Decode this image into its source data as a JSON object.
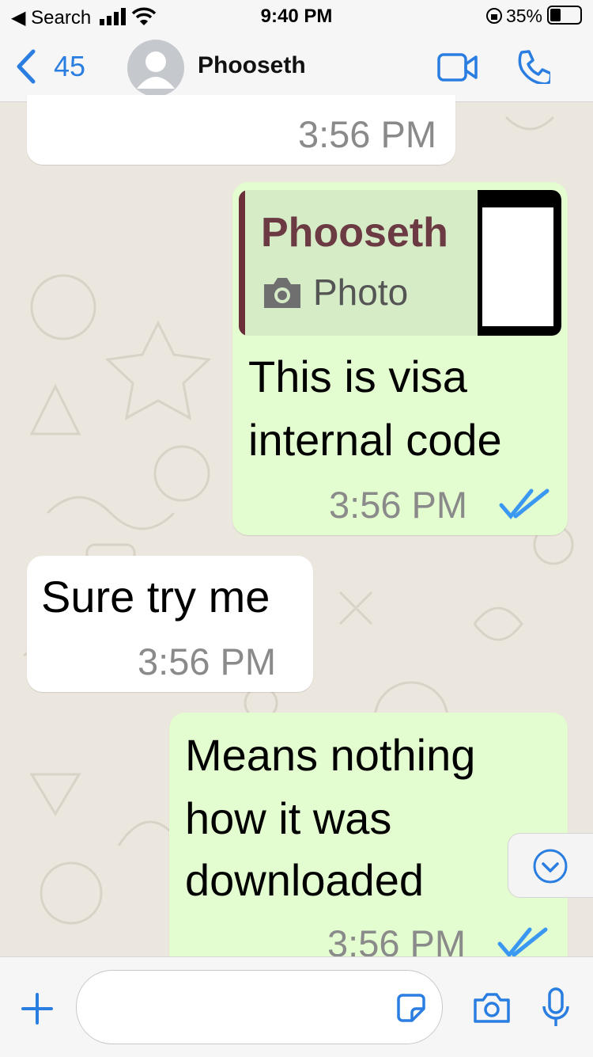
{
  "status_bar": {
    "back_label": "◀ Search",
    "time": "9:40 PM",
    "battery": "35%"
  },
  "nav": {
    "back_count": "45",
    "contact_name": "Phooseth"
  },
  "messages": [
    {
      "direction": "in",
      "text": "",
      "time": "3:56 PM"
    },
    {
      "direction": "out",
      "quoted_name": "Phooseth",
      "quoted_type": "Photo",
      "line1": "This is visa",
      "line2": "internal code",
      "time": "3:56 PM"
    },
    {
      "direction": "in",
      "text": "Sure try me",
      "time": "3:56 PM"
    },
    {
      "direction": "out",
      "line1": "Means nothing",
      "line2": "how it was",
      "line3": "downloaded",
      "time": "3:56 PM"
    }
  ],
  "input": {
    "placeholder": ""
  },
  "colors": {
    "accent": "#2a7de1",
    "outgoing_bubble": "#e3fcd0",
    "incoming_bubble": "#ffffff",
    "quote_bar": "#6b2f3a"
  }
}
